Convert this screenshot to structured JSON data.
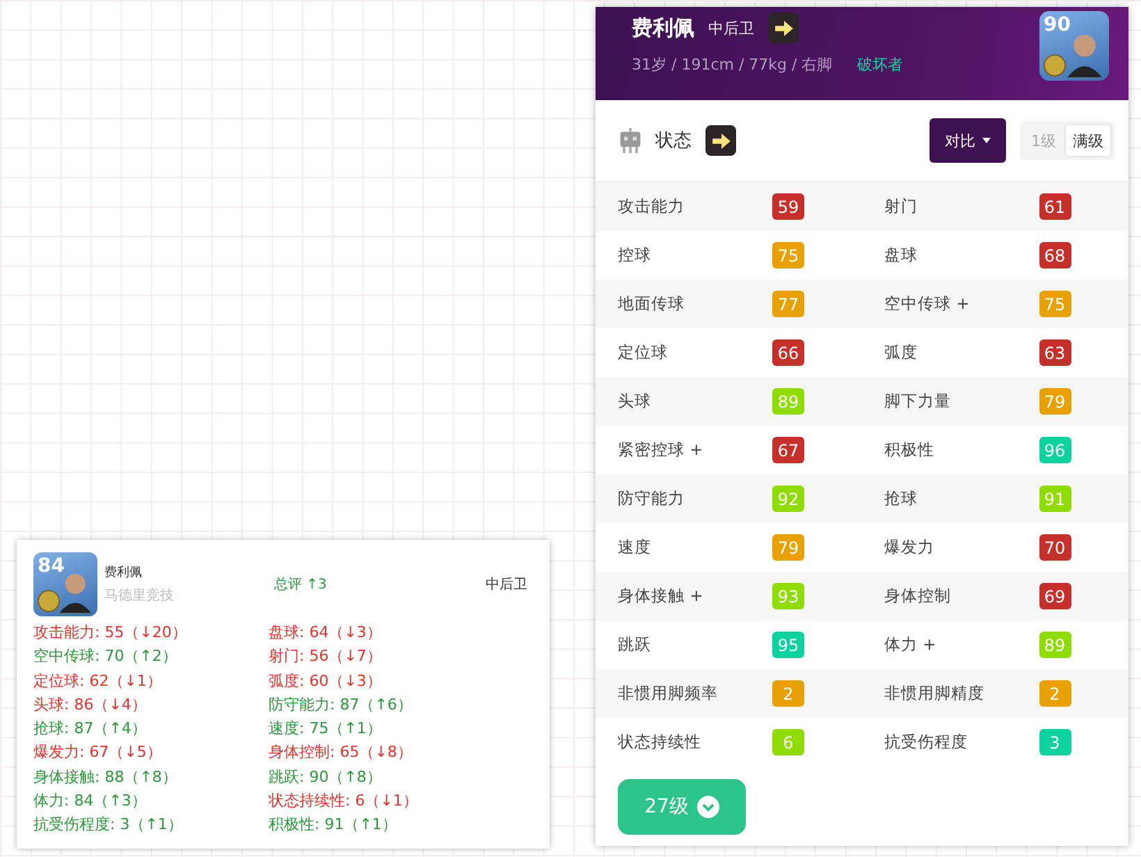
{
  "summary_card": {
    "rating": "84",
    "name": "费利佩",
    "club": "马德里竞技",
    "overall_change": "总评 ↑3",
    "position": "中后卫",
    "stats": [
      {
        "text": "攻击能力: 55（↓20）",
        "increased": false
      },
      {
        "text": "盘球: 64（↓3）",
        "increased": false
      },
      {
        "text": "空中传球: 70（↑2）",
        "increased": true
      },
      {
        "text": "射门: 56（↓7）",
        "increased": false
      },
      {
        "text": "定位球: 62（↓1）",
        "increased": false
      },
      {
        "text": "弧度: 60（↓3）",
        "increased": false
      },
      {
        "text": "头球: 86（↓4）",
        "increased": false
      },
      {
        "text": "防守能力: 87（↑6）",
        "increased": true
      },
      {
        "text": "抢球: 87（↑4）",
        "increased": true
      },
      {
        "text": "速度: 75（↑1）",
        "increased": true
      },
      {
        "text": "爆发力: 67（↓5）",
        "increased": false
      },
      {
        "text": "身体控制: 65（↓8）",
        "increased": false
      },
      {
        "text": "身体接触: 88（↑8）",
        "increased": true
      },
      {
        "text": "跳跃: 90（↑8）",
        "increased": true
      },
      {
        "text": "体力: 84（↑3）",
        "increased": true
      },
      {
        "text": "状态持续性: 6（↓1）",
        "increased": false
      },
      {
        "text": "抗受伤程度: 3（↑1）",
        "increased": true
      },
      {
        "text": "积极性: 91（↑1）",
        "increased": true
      }
    ]
  },
  "player_panel": {
    "name": "费利佩",
    "position": "中后卫",
    "info": "31岁 / 191cm / 77kg / 右脚",
    "style": "破坏者",
    "rating": "90",
    "section_title": "状态",
    "compare_button": "对比",
    "levels": [
      {
        "label": "1级",
        "selected": false
      },
      {
        "label": "满级",
        "selected": true
      }
    ],
    "stats": [
      {
        "label": "攻击能力",
        "value": "59",
        "color": "#c62f2a"
      },
      {
        "label": "射门",
        "value": "61",
        "color": "#c62f2a"
      },
      {
        "label": "控球",
        "value": "75",
        "color": "#e8a100"
      },
      {
        "label": "盘球",
        "value": "68",
        "color": "#c62f2a"
      },
      {
        "label": "地面传球",
        "value": "77",
        "color": "#e8a100"
      },
      {
        "label": "空中传球 +",
        "value": "75",
        "color": "#e8a100"
      },
      {
        "label": "定位球",
        "value": "66",
        "color": "#c62f2a"
      },
      {
        "label": "弧度",
        "value": "63",
        "color": "#c62f2a"
      },
      {
        "label": "头球",
        "value": "89",
        "color": "#8fdc00"
      },
      {
        "label": "脚下力量",
        "value": "79",
        "color": "#e8a100"
      },
      {
        "label": "紧密控球 +",
        "value": "67",
        "color": "#c62f2a"
      },
      {
        "label": "积极性",
        "value": "96",
        "color": "#0ad3a0"
      },
      {
        "label": "防守能力",
        "value": "92",
        "color": "#8fdc00"
      },
      {
        "label": "抢球",
        "value": "91",
        "color": "#8fdc00"
      },
      {
        "label": "速度",
        "value": "79",
        "color": "#e8a100"
      },
      {
        "label": "爆发力",
        "value": "70",
        "color": "#c62f2a"
      },
      {
        "label": "身体接触 +",
        "value": "93",
        "color": "#8fdc00"
      },
      {
        "label": "身体控制",
        "value": "69",
        "color": "#c62f2a"
      },
      {
        "label": "跳跃",
        "value": "95",
        "color": "#0ad3a0"
      },
      {
        "label": "体力 +",
        "value": "89",
        "color": "#8fdc00"
      },
      {
        "label": "非惯用脚频率",
        "value": "2",
        "color": "#e8a100"
      },
      {
        "label": "非惯用脚精度",
        "value": "2",
        "color": "#e8a100"
      },
      {
        "label": "状态持续性",
        "value": "6",
        "color": "#8fdc00"
      },
      {
        "label": "抗受伤程度",
        "value": "3",
        "color": "#0ad3a0"
      }
    ],
    "level_button": "27级"
  }
}
